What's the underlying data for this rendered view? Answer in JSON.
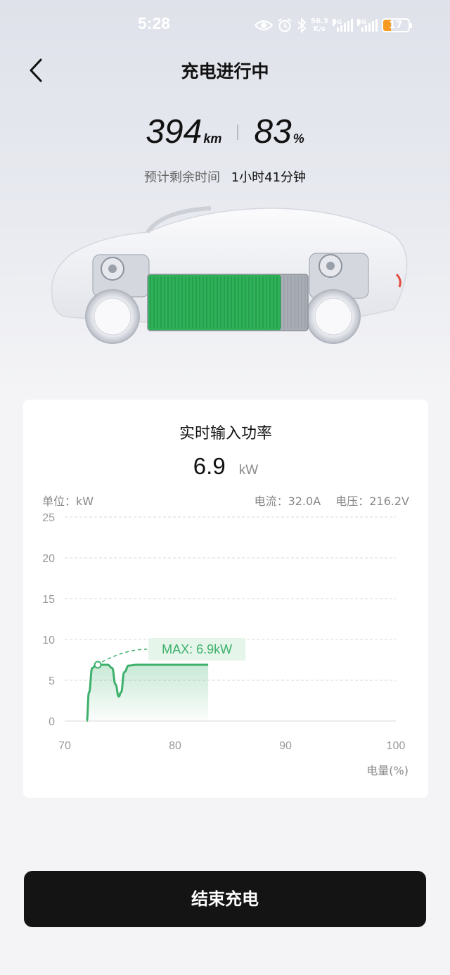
{
  "status_bar": {
    "time": "5:28",
    "net_speed_value": "56.3",
    "net_speed_unit": "K/s",
    "signal1_label": "4G",
    "signal2_label": "4G",
    "battery_level": "17",
    "battery_color": "#f59a23"
  },
  "header": {
    "title": "充电进行中",
    "back_icon": "chevron-left-icon"
  },
  "summary": {
    "range_value": "394",
    "range_unit": "km",
    "soc_value": "83",
    "soc_unit": "%",
    "remaining_label": "预计剩余时间",
    "remaining_value": "1小时41分钟"
  },
  "battery_fill_fraction": 0.83,
  "power_card": {
    "title": "实时输入功率",
    "value": "6.9",
    "unit": "kW",
    "unit_label": "单位：kW",
    "current_text": "电流：32.0A",
    "voltage_text": "电压：216.2V"
  },
  "chart_data": {
    "type": "line",
    "title": "实时输入功率",
    "xlabel": "电量(%)",
    "ylabel": "单位：kW",
    "xlim": [
      70,
      100
    ],
    "ylim": [
      0,
      25
    ],
    "x_ticks": [
      "70",
      "80",
      "90",
      "100"
    ],
    "y_ticks": [
      "0",
      "5",
      "10",
      "15",
      "20",
      "25"
    ],
    "grid": true,
    "series": [
      {
        "color": "#3db06c",
        "x": [
          72.0,
          72.2,
          72.5,
          72.9,
          73.4,
          73.9,
          74.3,
          74.6,
          74.9,
          75.1,
          75.4,
          75.8,
          76.5,
          78,
          80,
          83
        ],
        "y": [
          0.0,
          3.5,
          6.5,
          7.0,
          6.9,
          6.9,
          6.5,
          4.5,
          3.0,
          3.5,
          6.0,
          6.8,
          6.9,
          6.9,
          6.9,
          6.9
        ]
      }
    ],
    "max_annotation": {
      "text": "MAX: 6.9kW",
      "x": 73.0,
      "y": 6.9
    }
  },
  "actions": {
    "end_charging_label": "结束充电"
  }
}
